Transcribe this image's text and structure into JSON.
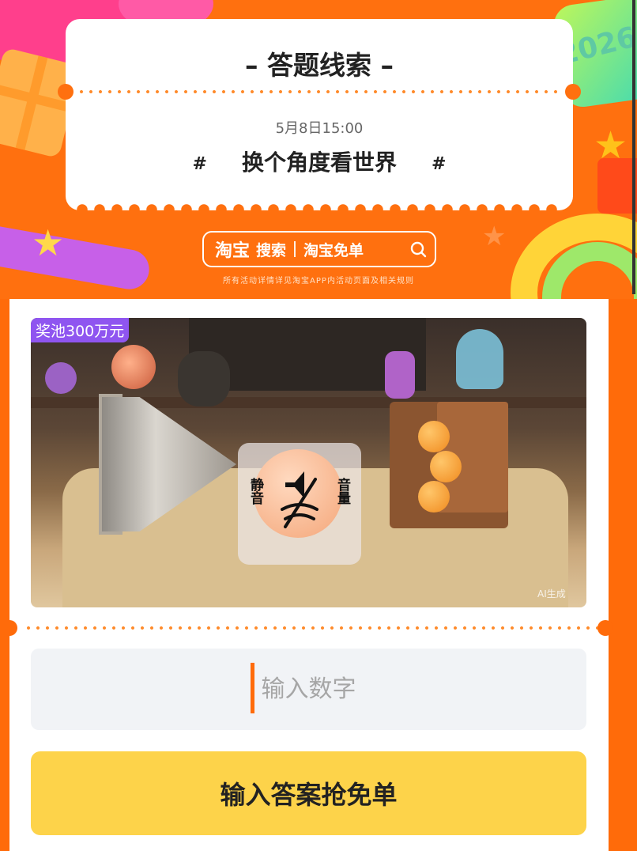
{
  "banner": {
    "title": "– 答题线索 –",
    "date": "5月8日15:00",
    "hash_left": "#",
    "topic": "换个角度看世界",
    "hash_right": "#",
    "deco_year": "2026",
    "search": {
      "logo": "淘宝",
      "search_label": "搜索",
      "query": "淘宝免单",
      "icon": "search-icon"
    },
    "disclaimer": "所有活动详情详见淘宝APP内活动页面及相关规则"
  },
  "hero": {
    "prize_tag": "奖池300万元",
    "ai_mark": "AI生成",
    "mute_overlay": {
      "left_label": "静音",
      "right_label": "音量",
      "icon": "speaker-muted-icon"
    }
  },
  "answer": {
    "input_value": "",
    "input_placeholder": "输入数字",
    "submit_label": "输入答案抢免单"
  },
  "colors": {
    "accent_orange": "#ff6b0a",
    "button_yellow": "#fdd34a",
    "tag_purple": "#8f55f0"
  }
}
